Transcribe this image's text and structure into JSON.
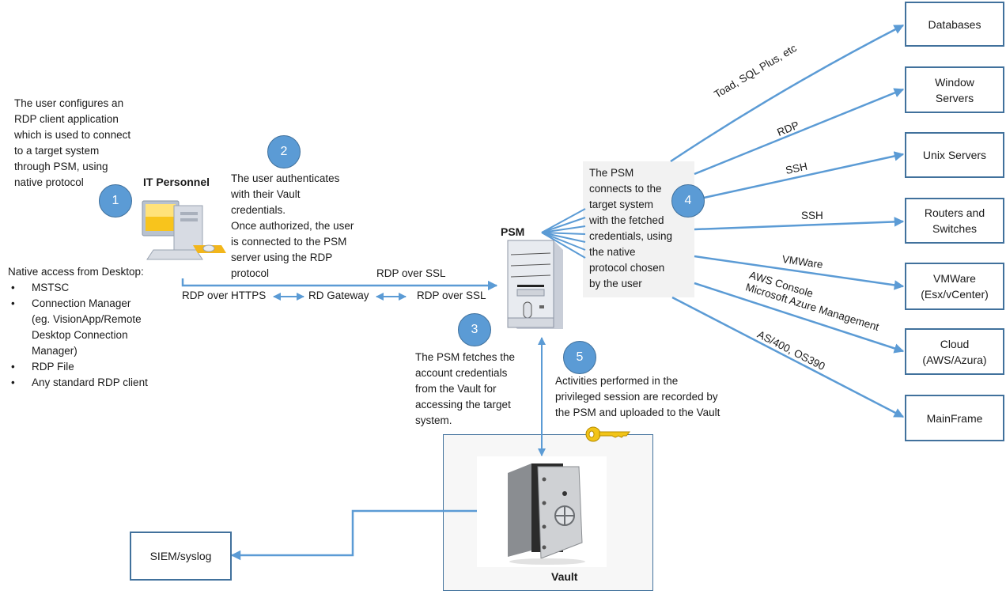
{
  "diagram": {
    "intro_note": "The user configures an\nRDP client application\nwhich is used to connect\nto a target system\nthrough PSM, using\nnative protocol",
    "it_personnel": {
      "label": "IT Personnel",
      "icon": "desktop-computer-icon"
    },
    "native_access": {
      "heading": "Native access from Desktop:",
      "items": [
        "MSTSC",
        "Connection Manager\n(eg. VisionApp/Remote\nDesktop Connection\nManager)",
        "RDP File",
        "Any standard RDP client"
      ]
    },
    "steps": [
      {
        "number": "1"
      },
      {
        "number": "2",
        "text": "The user authenticates\nwith their Vault\ncredentials.\nOnce authorized, the user\nis connected to the PSM\nserver using the RDP\nprotocol"
      },
      {
        "number": "3",
        "text": "The PSM fetches the\naccount credentials\nfrom the Vault for\naccessing the target\nsystem."
      },
      {
        "number": "4",
        "text": "The PSM\nconnects to the\ntarget system\nwith the fetched\ncredentials, using\nthe native\nprotocol chosen\nby the user"
      },
      {
        "number": "5",
        "text": "Activities performed in the\nprivileged session are recorded by\nthe PSM and uploaded to the Vault"
      }
    ],
    "connection_labels": {
      "rdp_over_ssl_top": "RDP over SSL",
      "rdp_over_https": "RDP over HTTPS",
      "rd_gateway": "RD Gateway",
      "rdp_over_ssl_bottom": "RDP over SSL"
    },
    "psm": {
      "label": "PSM",
      "icon": "server-tower-icon"
    },
    "vault": {
      "label": "Vault",
      "icon": "safe-icon",
      "key_icon": "key-icon"
    },
    "siem": {
      "label": "SIEM/syslog"
    },
    "targets": [
      {
        "label": "Databases",
        "protocol": "Toad, SQL Plus, etc"
      },
      {
        "label": "Window\nServers",
        "protocol": "RDP"
      },
      {
        "label": "Unix Servers",
        "protocol": "SSH"
      },
      {
        "label": "Routers and\nSwitches",
        "protocol": "SSH"
      },
      {
        "label": "VMWare\n(Esx/vCenter)",
        "protocol": "VMWare"
      },
      {
        "label": "Cloud\n(AWS/Azura)",
        "protocol": "AWS Console\nMicrosoft Azure Management"
      },
      {
        "label": "MainFrame",
        "protocol": "AS/400, OS390"
      }
    ],
    "colors": {
      "arrow": "#5b9bd5",
      "box_border": "#41719c",
      "step_circle": "#5b9bd5"
    }
  }
}
